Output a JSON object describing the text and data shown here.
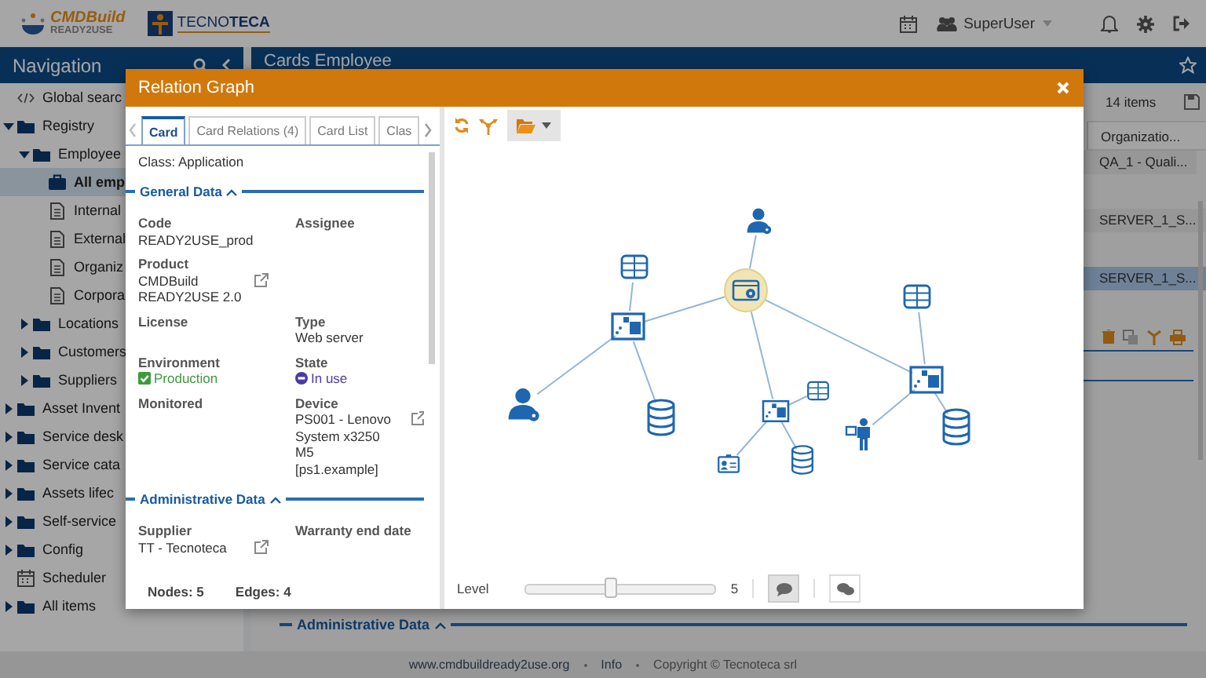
{
  "header": {
    "logo": {
      "title": "CMDBuild",
      "subtitle": "READY2USE"
    },
    "company": "TECNO**TECA**",
    "user": "SuperUser"
  },
  "navigation": {
    "title": "Navigation",
    "items": [
      {
        "label": "Global searc",
        "kind": "search",
        "selected": false
      },
      {
        "label": "Registry",
        "kind": "folder",
        "expanded": true,
        "selected": false,
        "children": [
          {
            "label": "Employee",
            "kind": "folder",
            "expanded": true,
            "selected": false,
            "children": [
              {
                "label": "All emp",
                "kind": "view",
                "selected": true
              },
              {
                "label": "Internal",
                "kind": "report",
                "selected": false
              },
              {
                "label": "External",
                "kind": "report",
                "selected": false
              },
              {
                "label": "Organiz",
                "kind": "report",
                "selected": false
              },
              {
                "label": "Corpora",
                "kind": "report",
                "selected": false
              }
            ]
          },
          {
            "label": "Locations",
            "kind": "folder",
            "expanded": false,
            "selected": false
          },
          {
            "label": "Customers",
            "kind": "folder",
            "expanded": false,
            "selected": false
          },
          {
            "label": "Suppliers",
            "kind": "folder",
            "expanded": false,
            "selected": false
          }
        ]
      },
      {
        "label": "Asset Invent",
        "kind": "folder",
        "expanded": false,
        "selected": false
      },
      {
        "label": "Service desk",
        "kind": "folder",
        "expanded": false,
        "selected": false
      },
      {
        "label": "Service cata",
        "kind": "folder",
        "expanded": false,
        "selected": false
      },
      {
        "label": "Assets lifec",
        "kind": "folder",
        "expanded": false,
        "selected": false
      },
      {
        "label": "Self-service",
        "kind": "folder",
        "expanded": false,
        "selected": false
      },
      {
        "label": "Config",
        "kind": "folder",
        "expanded": false,
        "selected": false
      },
      {
        "label": "Scheduler",
        "kind": "calendar",
        "selected": false
      },
      {
        "label": "All items",
        "kind": "folder",
        "expanded": false,
        "selected": false
      }
    ]
  },
  "main": {
    "title": "Cards Employee",
    "count": "14 items",
    "columns": [
      "Organizatio..."
    ],
    "rows": [
      {
        "cells": [
          "QA_1 - Quali..."
        ],
        "selected": false
      },
      {
        "cells": [
          "SERVER_1_S..."
        ],
        "selected": false
      },
      {
        "cells": [
          "SERVER_1_S..."
        ],
        "selected": true
      }
    ],
    "section": {
      "title": "Administrative Data",
      "expanded": true
    }
  },
  "dialog": {
    "title": "Relation Graph",
    "tabs": [
      {
        "label": "Card",
        "selected": true
      },
      {
        "label": "Card Relations (4)",
        "selected": false
      },
      {
        "label": "Card List",
        "selected": false
      },
      {
        "label": "Clas",
        "selected": false
      }
    ],
    "class_line": "Class: Application",
    "sections": [
      {
        "title": "General Data",
        "expanded": true,
        "rows": [
          [
            {
              "label": "Code",
              "value": [
                "READY2USE_prod"
              ],
              "kind": "text",
              "link": false
            },
            {
              "label": "Assignee",
              "kind": "text",
              "link": false
            }
          ],
          [
            {
              "label": "Product",
              "value": [
                "CMDBuild",
                "READY2USE 2.0"
              ],
              "kind": "text",
              "link": true
            }
          ],
          [
            {
              "label": "License",
              "kind": "text",
              "link": false
            },
            {
              "label": "Type",
              "value": [
                "Web server"
              ],
              "kind": "text",
              "link": false
            }
          ],
          [
            {
              "label": "Environment",
              "value": [
                "Production"
              ],
              "kind": "checkbox",
              "checked": true,
              "color": "#3d9a3d",
              "link": false
            },
            {
              "label": "State",
              "value": [
                "In use"
              ],
              "kind": "status",
              "color": "#4b3aa6",
              "link": false
            }
          ],
          [
            {
              "label": "Monitored",
              "kind": "text",
              "link": false
            },
            {
              "label": "Device",
              "value": [
                "PS001 - Lenovo",
                "System x3250",
                "M5",
                "[ps1.example]"
              ],
              "kind": "text",
              "link": true
            }
          ]
        ]
      },
      {
        "title": "Administrative Data",
        "expanded": true,
        "rows": [
          [
            {
              "label": "Supplier",
              "value": [
                "TT - Tecnoteca"
              ],
              "kind": "text",
              "link": true
            },
            {
              "label": "Warranty end date",
              "kind": "text",
              "link": false
            }
          ]
        ]
      }
    ],
    "nodes_count": "Nodes: 5",
    "edges_count": "Edges: 4",
    "graph": {
      "nodes": [
        {
          "kind": "application",
          "selected": true,
          "children": [
            {
              "kind": "user",
              "selected": false
            },
            {
              "kind": "cluster",
              "selected": false,
              "children": [
                {
                  "kind": "server",
                  "selected": false
                },
                {
                  "kind": "user",
                  "selected": false
                },
                {
                  "kind": "database",
                  "selected": false
                }
              ]
            },
            {
              "kind": "cluster",
              "selected": false,
              "children": [
                {
                  "kind": "server",
                  "selected": false
                },
                {
                  "kind": "idcard",
                  "selected": false
                },
                {
                  "kind": "database",
                  "selected": false
                }
              ]
            },
            {
              "kind": "cluster",
              "selected": false,
              "children": [
                {
                  "kind": "server",
                  "selected": false
                },
                {
                  "kind": "person",
                  "selected": false
                },
                {
                  "kind": "database",
                  "selected": false
                }
              ]
            }
          ]
        }
      ],
      "level_label": "Level",
      "level": 0.45,
      "reading": "5",
      "buttons": [
        {
          "kind": "comment",
          "selected": true
        },
        {
          "kind": "comments",
          "selected": false
        }
      ]
    }
  },
  "footer": {
    "links": [
      {
        "label": "www.cmdbuildready2use.org",
        "kind": "link"
      },
      {
        "label": "Info",
        "kind": "link"
      },
      {
        "label": "Copyright © Tecnoteca srl",
        "kind": "text"
      }
    ]
  }
}
